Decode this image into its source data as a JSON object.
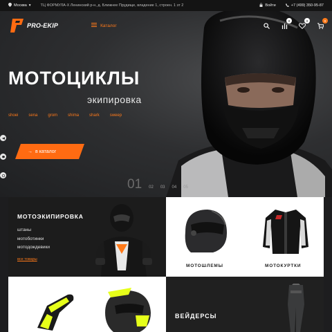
{
  "topbar": {
    "city": "Москва",
    "address": "ТЦ ФОРМУЛА-Х Ленинский р-н, д. Ближнее Прудище, владение 1, строен. 1 эт 2",
    "login": "Войти",
    "phone": "+7 (499) 350-95-87"
  },
  "header": {
    "logo_text": "PRO-EKIP",
    "catalog_label": "Каталог",
    "compare_count": "0",
    "favorites_count": "0",
    "cart_count": "0"
  },
  "hero": {
    "title": "МОТОЦИКЛЫ",
    "subtitle": "экипировка",
    "brands": [
      "shoei",
      "sena",
      "grom",
      "shima",
      "shark",
      "sweep"
    ],
    "cta_label": "в каталог",
    "slides": [
      "01",
      "02",
      "03",
      "04",
      "05"
    ]
  },
  "tiles": {
    "moto_equipment": {
      "title": "МОТОЭКИПИРОВКА",
      "items": [
        "штаны",
        "мотоботинки",
        "мотодождевики"
      ],
      "all_link": "все товары"
    },
    "helmets_label": "МОТОШЛЕМЫ",
    "jackets_label": "МОТОКУРТКИ",
    "waders_label": "ВЕЙДЕРСЫ"
  },
  "colors": {
    "accent": "#ff6b12",
    "dark": "#1c1c1c"
  }
}
